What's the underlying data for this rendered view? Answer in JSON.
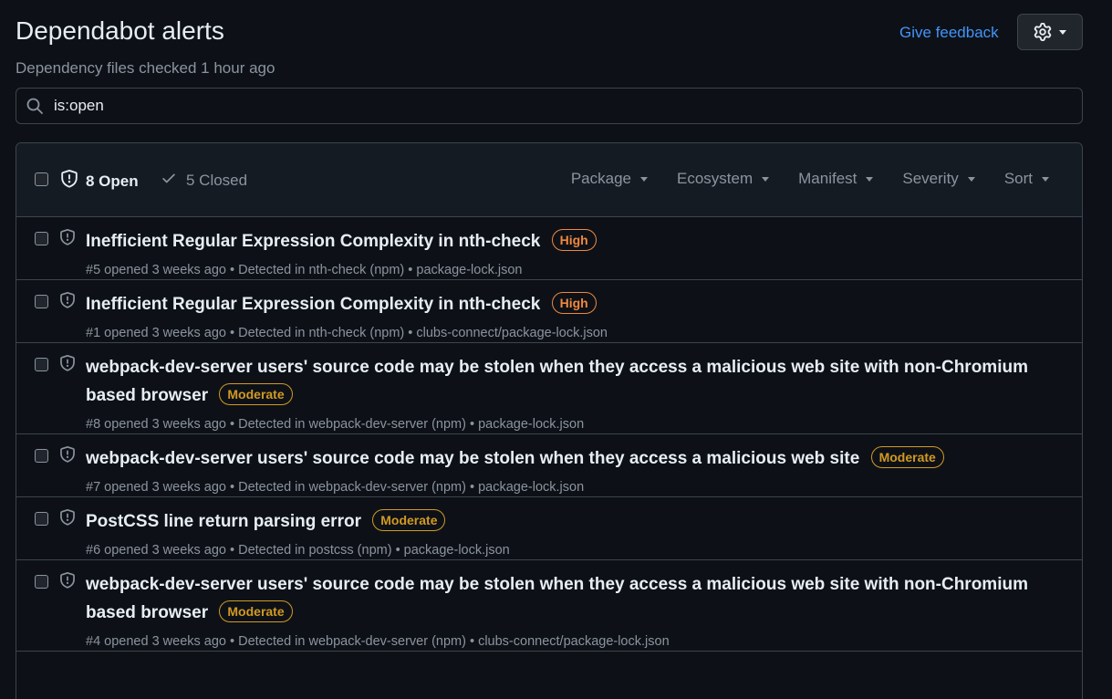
{
  "header": {
    "title": "Dependabot alerts",
    "subtitle": "Dependency files checked 1 hour ago",
    "feedback_label": "Give feedback",
    "settings_icon": "gear-icon"
  },
  "search": {
    "value": "is:open",
    "icon": "search-icon"
  },
  "toolbar": {
    "open_label": "8 Open",
    "closed_label": "5 Closed",
    "filters": [
      "Package",
      "Ecosystem",
      "Manifest",
      "Severity",
      "Sort"
    ]
  },
  "colors": {
    "background": "#0d1117",
    "header_bg": "#151b23",
    "border": "#3d444d",
    "link": "#4493f8",
    "high": "#f0883e",
    "moderate": "#d29922",
    "muted": "#8b949e"
  },
  "alerts": [
    {
      "title": "Inefficient Regular Expression Complexity in nth-check",
      "severity": "High",
      "meta": "#5 opened 3 weeks ago • Detected in nth-check (npm) • package-lock.json"
    },
    {
      "title": "Inefficient Regular Expression Complexity in nth-check",
      "severity": "High",
      "meta": "#1 opened 3 weeks ago • Detected in nth-check (npm) • clubs-connect/package-lock.json"
    },
    {
      "title": "webpack-dev-server users' source code may be stolen when they access a malicious web site with non-Chromium based browser",
      "severity": "Moderate",
      "meta": "#8 opened 3 weeks ago • Detected in webpack-dev-server (npm) • package-lock.json"
    },
    {
      "title": "webpack-dev-server users' source code may be stolen when they access a malicious web site",
      "severity": "Moderate",
      "meta": "#7 opened 3 weeks ago • Detected in webpack-dev-server (npm) • package-lock.json"
    },
    {
      "title": "PostCSS line return parsing error",
      "severity": "Moderate",
      "meta": "#6 opened 3 weeks ago • Detected in postcss (npm) • package-lock.json"
    },
    {
      "title": "webpack-dev-server users' source code may be stolen when they access a malicious web site with non-Chromium based browser",
      "severity": "Moderate",
      "meta": "#4 opened 3 weeks ago • Detected in webpack-dev-server (npm) • clubs-connect/package-lock.json"
    }
  ]
}
